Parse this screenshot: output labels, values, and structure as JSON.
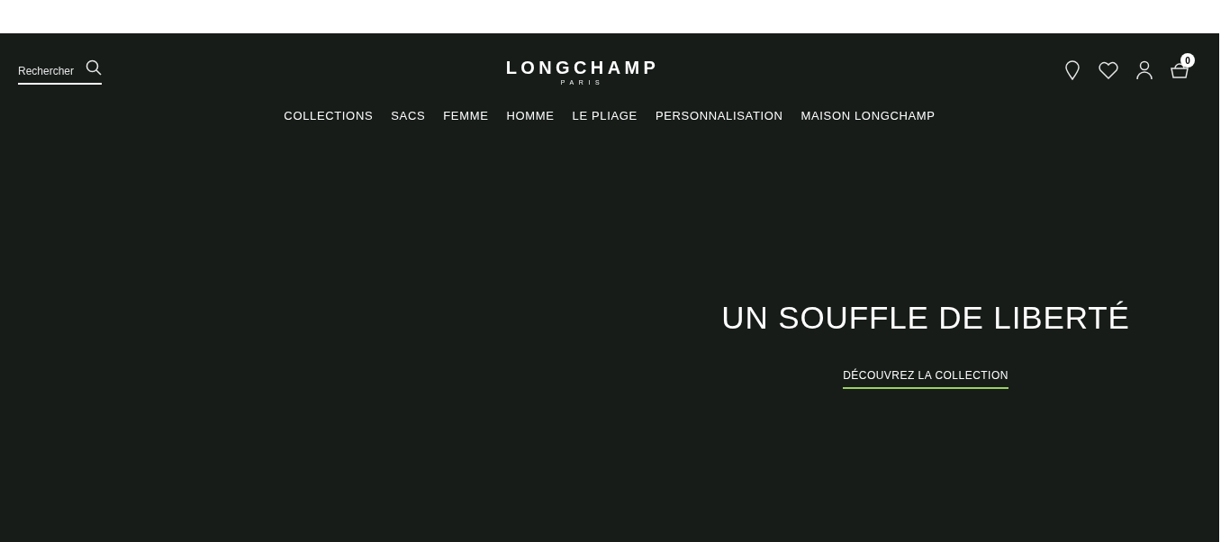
{
  "header": {
    "search": {
      "placeholder": "Rechercher"
    },
    "logo": {
      "name": "LONGCHAMP",
      "subtitle": "PARIS"
    },
    "cart_count": "0"
  },
  "nav": [
    "COLLECTIONS",
    "SACS",
    "FEMME",
    "HOMME",
    "LE PLIAGE",
    "PERSONNALISATION",
    "MAISON LONGCHAMP"
  ],
  "hero": {
    "title": "UN SOUFFLE DE LIBERTÉ",
    "link": "DÉCOUVREZ LA COLLECTION"
  }
}
